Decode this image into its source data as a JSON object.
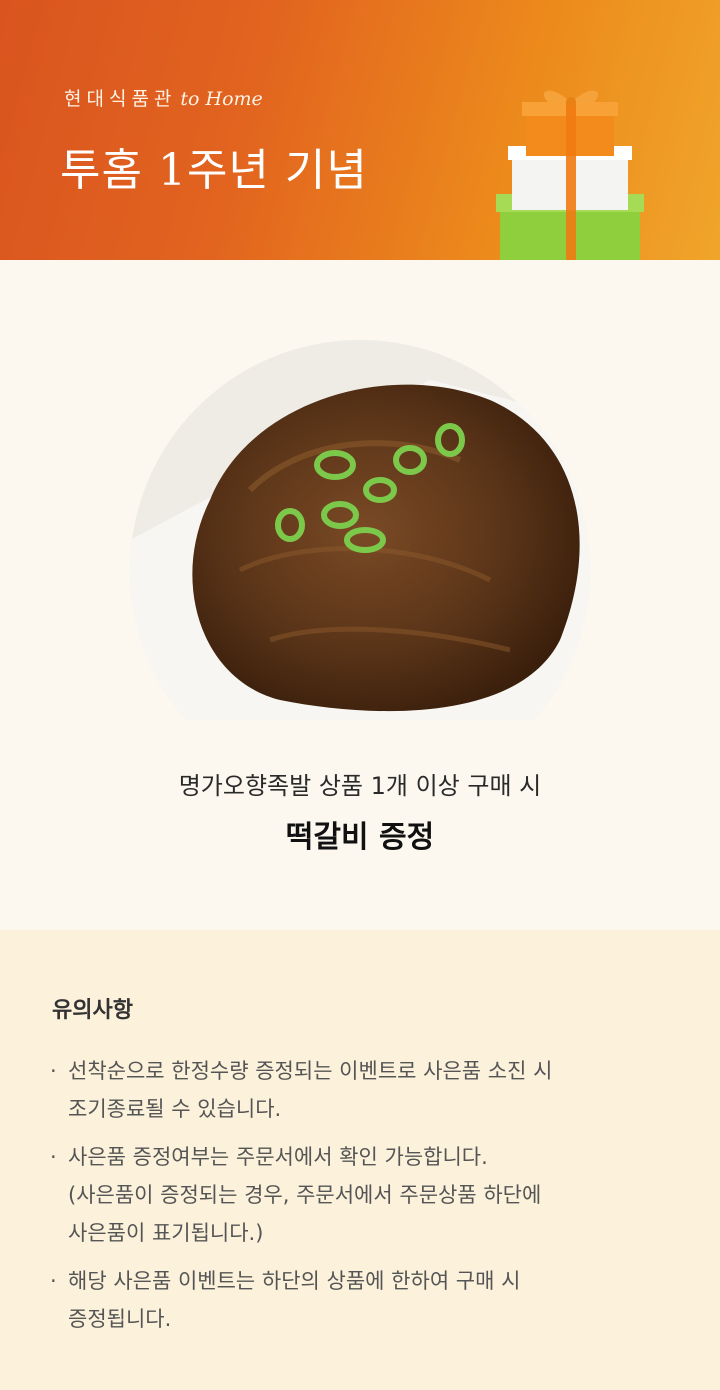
{
  "banner": {
    "brand_kr": "현대식품관",
    "brand_script": "to Home",
    "headline": "투홈 1주년 기념"
  },
  "gift_icon": "gift-boxes-icon",
  "offer": {
    "line": "명가오향족발 상품 1개 이상 구매 시",
    "title": "떡갈비 증정"
  },
  "notice": {
    "title": "유의사항",
    "items": [
      {
        "lines": [
          "선착순으로 한정수량 증정되는 이벤트로 사은품 소진 시",
          "조기종료될 수 있습니다."
        ]
      },
      {
        "lines": [
          "사은품 증정여부는 주문서에서 확인 가능합니다.",
          "(사은품이 증정되는 경우, 주문서에서 주문상품 하단에",
          "사은품이 표기됩니다.)"
        ]
      },
      {
        "lines": [
          "해당 사은품 이벤트는 하단의 상품에 한하여 구매 시",
          "증정됩니다."
        ]
      }
    ]
  },
  "colors": {
    "banner_start": "#d9541f",
    "banner_end": "#f0a52a",
    "cream": "#fcf8ef",
    "notice_bg": "#fcf2dc"
  }
}
